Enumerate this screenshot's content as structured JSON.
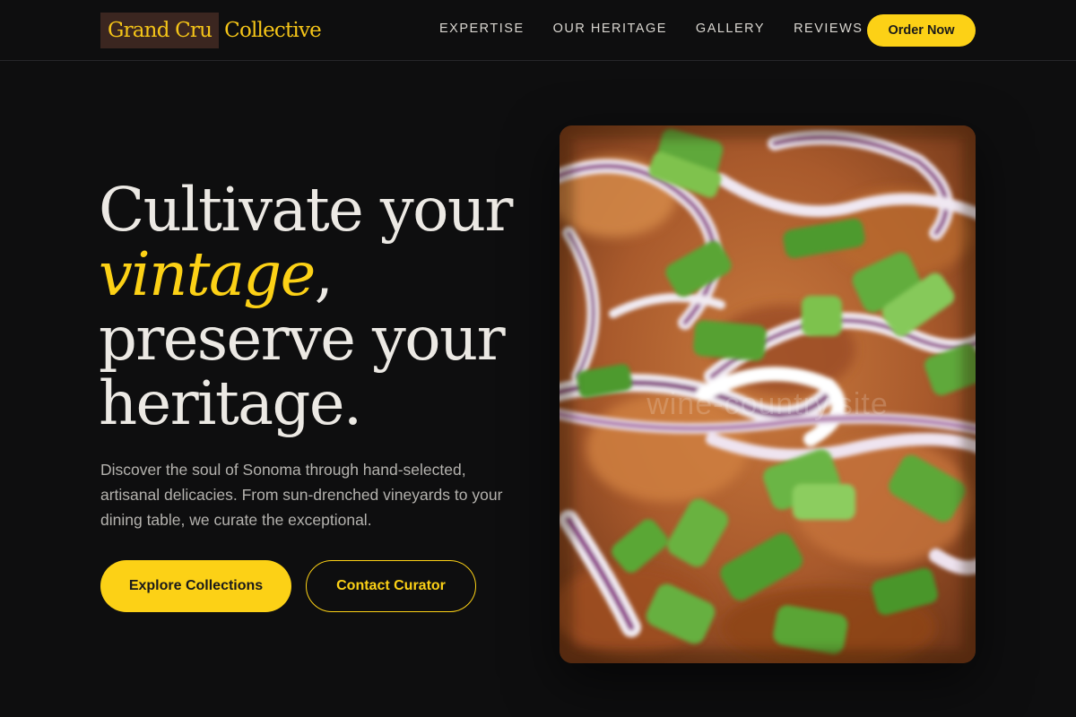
{
  "brand": {
    "name_part1": "Grand Cru",
    "name_part2": "Collective"
  },
  "nav": {
    "items": [
      {
        "label": "EXPERTISE"
      },
      {
        "label": "OUR HERITAGE"
      },
      {
        "label": "GALLERY"
      },
      {
        "label": "REVIEWS"
      }
    ],
    "cta_label": "Order Now"
  },
  "hero": {
    "headline_line1": "Cultivate your",
    "headline_accent": "vintage",
    "headline_comma": ",",
    "headline_line3": "preserve your",
    "headline_line4": "heritage.",
    "description": "Discover the soul of Sonoma through hand-selected, artisanal delicacies. From sun-drenched vineyards to your dining table, we curate the exceptional.",
    "primary_button": "Explore Collections",
    "secondary_button": "Contact Curator",
    "image_watermark": "wine-country.site"
  },
  "colors": {
    "background": "#0e0e0f",
    "accent": "#fcd116",
    "text": "#ece9e4",
    "muted_text": "#b4b2ae",
    "logo_box": "#3b2620"
  },
  "icons": {
    "hero_image": "food-photo-onions-scallions"
  }
}
